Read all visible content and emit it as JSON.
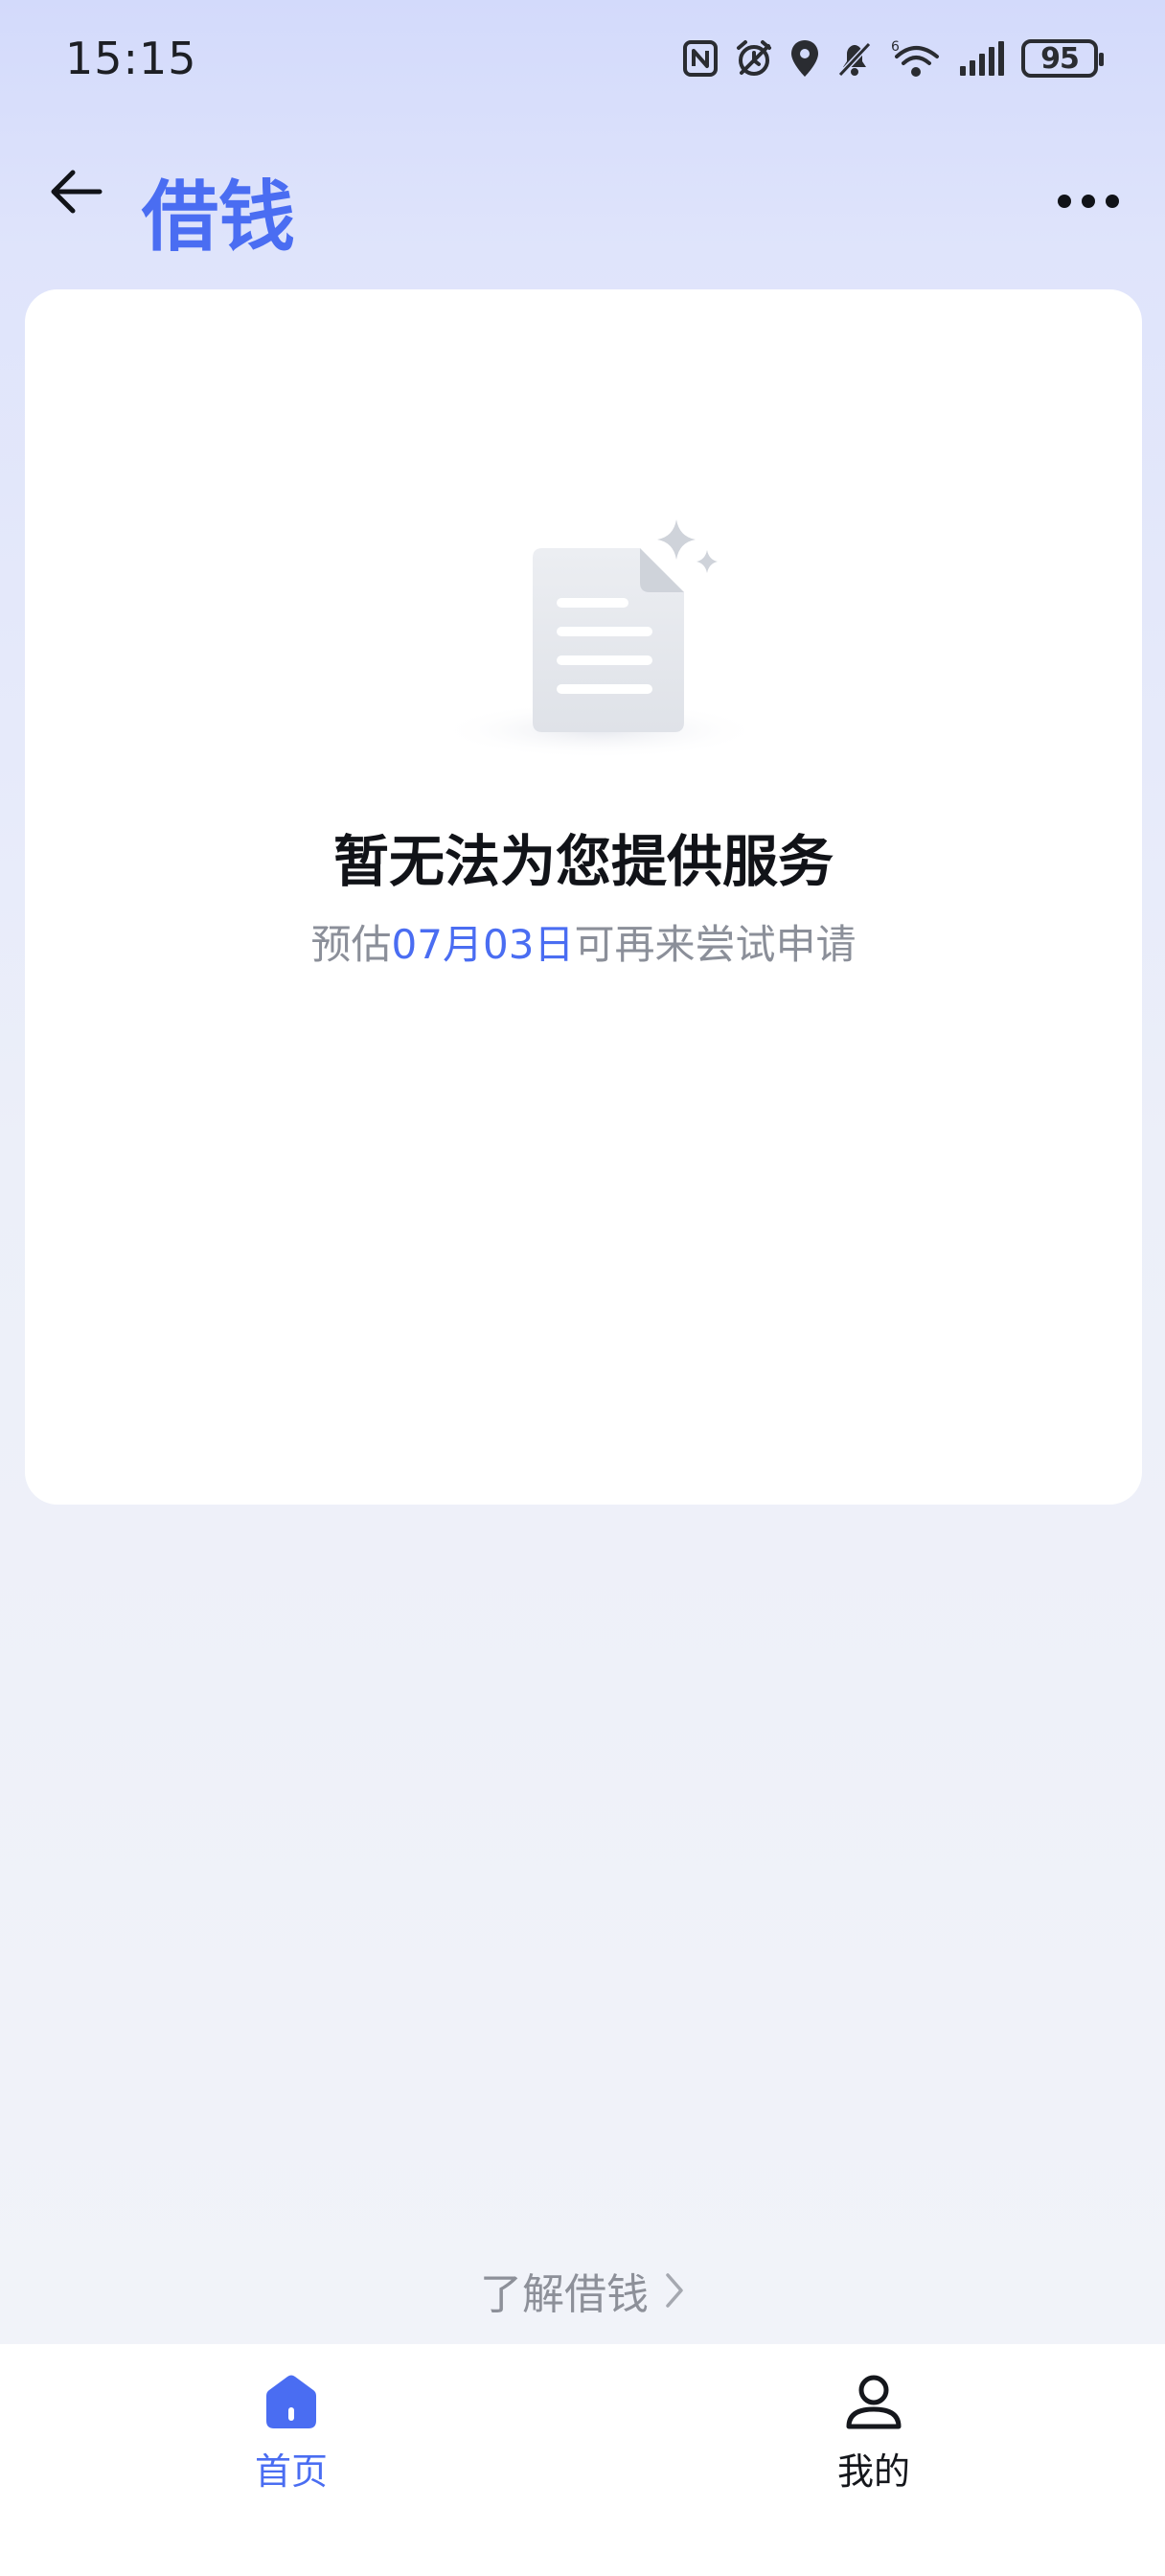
{
  "status_bar": {
    "time": "15:15",
    "battery": "95",
    "icons": [
      "nfc-icon",
      "alarm-icon",
      "location-icon",
      "mute-icon",
      "wifi-6-icon",
      "signal-icon",
      "battery-icon"
    ]
  },
  "header": {
    "title": "借钱",
    "back_icon": "arrow-left-icon",
    "more_icon": "more-dots-icon"
  },
  "empty_state": {
    "icon": "empty-document-icon",
    "title": "暂无法为您提供服务",
    "subtitle_prefix": "预估",
    "subtitle_date": "07月03日",
    "subtitle_suffix": "可再来尝试申请"
  },
  "learn_link": {
    "label": "了解借钱",
    "icon": "chevron-right-icon"
  },
  "bottom_nav": {
    "items": [
      {
        "label": "首页",
        "icon": "home-icon",
        "active": true
      },
      {
        "label": "我的",
        "icon": "user-icon",
        "active": false
      }
    ]
  },
  "colors": {
    "accent": "#4a6df2",
    "title_text": "#111318",
    "muted_text": "#8b8f99"
  }
}
